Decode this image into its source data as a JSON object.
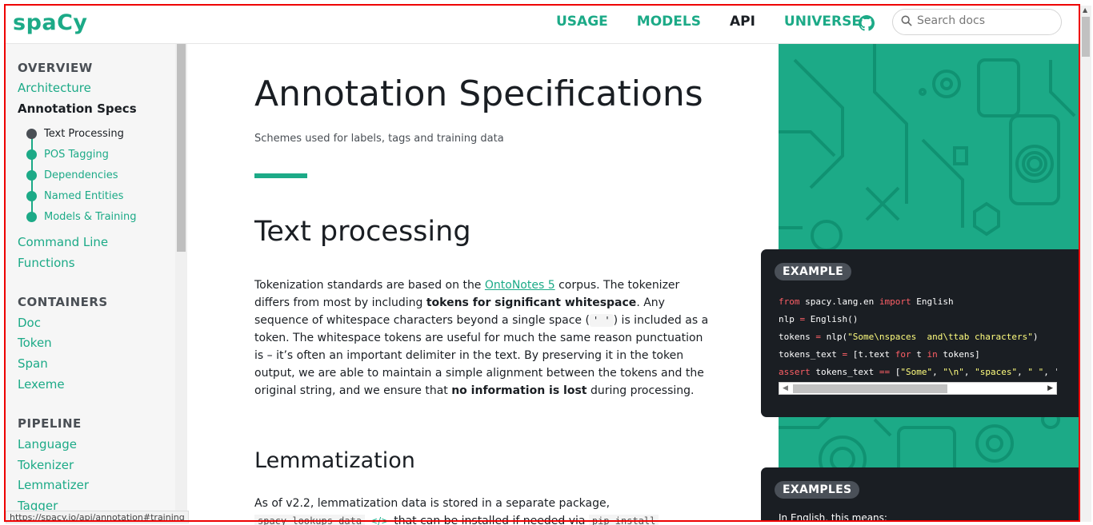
{
  "header": {
    "logo": "spaCy",
    "nav": [
      "USAGE",
      "MODELS",
      "API",
      "UNIVERSE"
    ],
    "search_placeholder": "Search docs"
  },
  "sidebar": {
    "sections": [
      {
        "title": "OVERVIEW",
        "items": [
          "Architecture",
          "Annotation Specs"
        ]
      },
      {
        "title": "CONTAINERS",
        "items": [
          "Doc",
          "Token",
          "Span",
          "Lexeme"
        ]
      },
      {
        "title": "PIPELINE",
        "items": [
          "Language",
          "Tokenizer",
          "Lemmatizer",
          "Tagger"
        ]
      }
    ],
    "subitems": [
      "Text Processing",
      "POS Tagging",
      "Dependencies",
      "Named Entities",
      "Models & Training"
    ],
    "more_items": [
      "Command Line",
      "Functions"
    ]
  },
  "status_url": "https://spacy.io/api/annotation#training",
  "main": {
    "title": "Annotation Specifications",
    "subtitle": "Schemes used for labels, tags and training data",
    "section1_title": "Text processing",
    "p1_a": "Tokenization standards are based on the ",
    "p1_link": "OntoNotes 5",
    "p1_b": " corpus. The tokenizer differs from most by including ",
    "p1_bold1": "tokens for significant whitespace",
    "p1_c": ". Any sequence of whitespace characters beyond a single space (",
    "p1_code": "' '",
    "p1_d": ") is included as a token. The whitespace tokens are useful for much the same reason punctuation is – it’s often an important delimiter in the text. By preserving it in the token output, we are able to maintain a simple alignment between the tokens and the original string, and we ensure that ",
    "p1_bold2": "no information is lost",
    "p1_e": " during processing.",
    "section2_title": "Lemmatization",
    "p2_a": "As of v2.2, lemmatization data is stored in a separate package,",
    "p2_code1": "spacy-lookups-data",
    "p2_tag": "</>",
    "p2_b": "that can be installed if needed via",
    "p2_code2": "pip install"
  },
  "example": {
    "label": "EXAMPLE",
    "line1_kw1": "from",
    "line1_mid": " spacy.lang.en ",
    "line1_kw2": "import",
    "line1_end": " English",
    "line2_a": "nlp ",
    "line2_op": "=",
    "line2_b": " English()",
    "line3_a": "tokens ",
    "line3_op": "=",
    "line3_b": " nlp(",
    "line3_str": "\"Some\\nspaces  and\\ttab characters\"",
    "line3_c": ")",
    "line4_a": "tokens_text ",
    "line4_op": "=",
    "line4_b": " [t.text ",
    "line4_kw": "for",
    "line4_c": " t ",
    "line4_kw2": "in",
    "line4_d": " tokens]",
    "line5_kw": "assert",
    "line5_a": " tokens_text ",
    "line5_op": "==",
    "line5_b": " [",
    "line5_s1": "\"Some\"",
    "line5_c1": ", ",
    "line5_s2": "\"\\n\"",
    "line5_c2": ", ",
    "line5_s3": "\"spaces\"",
    "line5_c3": ", ",
    "line5_s4": "\" \"",
    "line5_c4": ", '"
  },
  "examples": {
    "label": "EXAMPLES",
    "text": "In English, this means:"
  }
}
